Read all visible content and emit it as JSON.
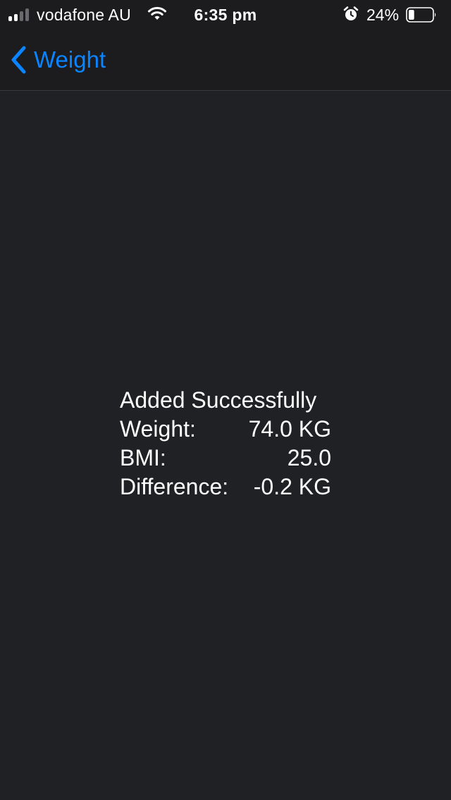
{
  "status_bar": {
    "carrier": "vodafone AU",
    "time": "6:35 pm",
    "battery_percent": "24%",
    "battery_level": 0.24,
    "signal_bars_filled": 2,
    "signal_bars_total": 4,
    "icons": [
      "signal-icon",
      "wifi-icon",
      "alarm-icon",
      "battery-icon"
    ]
  },
  "nav": {
    "back_label": "Weight",
    "accent_color": "#0a84ff"
  },
  "result": {
    "title": "Added Successfully",
    "rows": [
      {
        "label": "Weight:",
        "value": "74.0 KG"
      },
      {
        "label": "BMI:",
        "value": "25.0"
      },
      {
        "label": "Difference:",
        "value": "-0.2 KG"
      }
    ]
  },
  "colors": {
    "background": "#202125",
    "bar_background": "#1c1c1e",
    "text": "#ffffff"
  }
}
